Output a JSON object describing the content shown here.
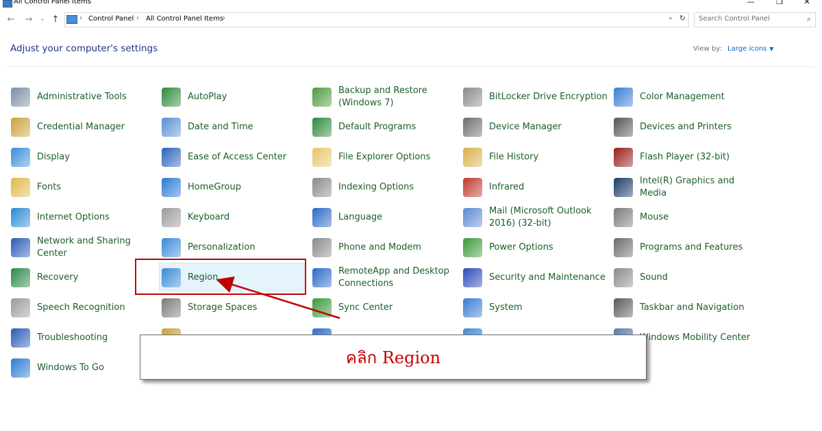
{
  "window": {
    "title": "All Control Panel Items",
    "minimize": "—",
    "maximize": "❐",
    "close": "✕"
  },
  "nav": {
    "back": "←",
    "forward": "→",
    "dropdown": "⌄",
    "up": "↑",
    "refresh": "↻",
    "separator": "›"
  },
  "breadcrumb": [
    "Control Panel",
    "All Control Panel Items"
  ],
  "search": {
    "placeholder": "Search Control Panel",
    "icon": "search-icon"
  },
  "heading": "Adjust your computer's settings",
  "view_by": {
    "label": "View by:",
    "value": "Large icons"
  },
  "items": [
    {
      "label": "Administrative Tools",
      "icon": "admin-tools-icon",
      "color": "#7a8ea5"
    },
    {
      "label": "AutoPlay",
      "icon": "autoplay-icon",
      "color": "#2e8b3a"
    },
    {
      "label": "Backup and Restore (Windows 7)",
      "icon": "backup-icon",
      "color": "#4c9a3a"
    },
    {
      "label": "BitLocker Drive Encryption",
      "icon": "bitlocker-icon",
      "color": "#8a8a8a"
    },
    {
      "label": "Color Management",
      "icon": "color-management-icon",
      "color": "#3a7fd4"
    },
    {
      "label": "Credential Manager",
      "icon": "credential-manager-icon",
      "color": "#c9a23a"
    },
    {
      "label": "Date and Time",
      "icon": "date-time-icon",
      "color": "#5b8fd6"
    },
    {
      "label": "Default Programs",
      "icon": "default-programs-icon",
      "color": "#2a8a3a"
    },
    {
      "label": "Device Manager",
      "icon": "device-manager-icon",
      "color": "#6d6d6d"
    },
    {
      "label": "Devices and Printers",
      "icon": "printer-icon",
      "color": "#555555"
    },
    {
      "label": "Display",
      "icon": "display-icon",
      "color": "#3a8fd8"
    },
    {
      "label": "Ease of Access Center",
      "icon": "ease-of-access-icon",
      "color": "#2a63b8"
    },
    {
      "label": "File Explorer Options",
      "icon": "folder-options-icon",
      "color": "#e8c56a"
    },
    {
      "label": "File History",
      "icon": "file-history-icon",
      "color": "#d9b04a"
    },
    {
      "label": "Flash Player (32-bit)",
      "icon": "flash-icon",
      "color": "#9a1a1a"
    },
    {
      "label": "Fonts",
      "icon": "fonts-icon",
      "color": "#e0b84a"
    },
    {
      "label": "HomeGroup",
      "icon": "homegroup-icon",
      "color": "#2a7ad4"
    },
    {
      "label": "Indexing Options",
      "icon": "indexing-icon",
      "color": "#8a8a8a"
    },
    {
      "label": "Infrared",
      "icon": "infrared-icon",
      "color": "#c0392b"
    },
    {
      "label": "Intel(R) Graphics and Media",
      "icon": "intel-graphics-icon",
      "color": "#1a3a6a"
    },
    {
      "label": "Internet Options",
      "icon": "internet-options-icon",
      "color": "#2a8ad4"
    },
    {
      "label": "Keyboard",
      "icon": "keyboard-icon",
      "color": "#9a9a9a"
    },
    {
      "label": "Language",
      "icon": "language-icon",
      "color": "#2a6ac8"
    },
    {
      "label": "Mail (Microsoft Outlook 2016) (32-bit)",
      "icon": "mail-icon",
      "color": "#5a8ad4"
    },
    {
      "label": "Mouse",
      "icon": "mouse-icon",
      "color": "#7a7a7a"
    },
    {
      "label": "Network and Sharing Center",
      "icon": "network-icon",
      "color": "#2a5ab8"
    },
    {
      "label": "Personalization",
      "icon": "personalization-icon",
      "color": "#3a8ad8"
    },
    {
      "label": "Phone and Modem",
      "icon": "phone-modem-icon",
      "color": "#8a8a8a"
    },
    {
      "label": "Power Options",
      "icon": "power-options-icon",
      "color": "#3a9a3a"
    },
    {
      "label": "Programs and Features",
      "icon": "programs-features-icon",
      "color": "#6a6a6a"
    },
    {
      "label": "Recovery",
      "icon": "recovery-icon",
      "color": "#2a8a4a"
    },
    {
      "label": "Region",
      "icon": "region-icon",
      "color": "#3a8ad4"
    },
    {
      "label": "RemoteApp and Desktop Connections",
      "icon": "remoteapp-icon",
      "color": "#2a6ac8"
    },
    {
      "label": "Security and Maintenance",
      "icon": "security-flag-icon",
      "color": "#2a4ab8"
    },
    {
      "label": "Sound",
      "icon": "sound-icon",
      "color": "#8a8a8a"
    },
    {
      "label": "Speech Recognition",
      "icon": "microphone-icon",
      "color": "#9a9a9a"
    },
    {
      "label": "Storage Spaces",
      "icon": "storage-spaces-icon",
      "color": "#7a7a7a"
    },
    {
      "label": "Sync Center",
      "icon": "sync-center-icon",
      "color": "#3a9a3a"
    },
    {
      "label": "System",
      "icon": "system-icon",
      "color": "#3a7ad4"
    },
    {
      "label": "Taskbar and Navigation",
      "icon": "taskbar-icon",
      "color": "#5a5a5a"
    },
    {
      "label": "Troubleshooting",
      "icon": "troubleshooting-icon",
      "color": "#2a5ab8"
    },
    {
      "label": "",
      "icon": "user-accounts-icon",
      "color": "#c9a23a"
    },
    {
      "label": "",
      "icon": "firewall-icon",
      "color": "#2a6ac8"
    },
    {
      "label": "",
      "icon": "defender-icon",
      "color": "#3a8ad4"
    },
    {
      "label": "Windows Mobility Center",
      "icon": "mobility-center-icon",
      "color": "#5a7aa8"
    },
    {
      "label": "Windows To Go",
      "icon": "windows-to-go-icon",
      "color": "#2a7ad4"
    }
  ],
  "callout": {
    "text": "คลิก Region"
  },
  "accents": {
    "item_text": "#1a5e28",
    "heading": "#1e3287",
    "annotation": "#c00000",
    "hover": "#e5f3fb"
  }
}
